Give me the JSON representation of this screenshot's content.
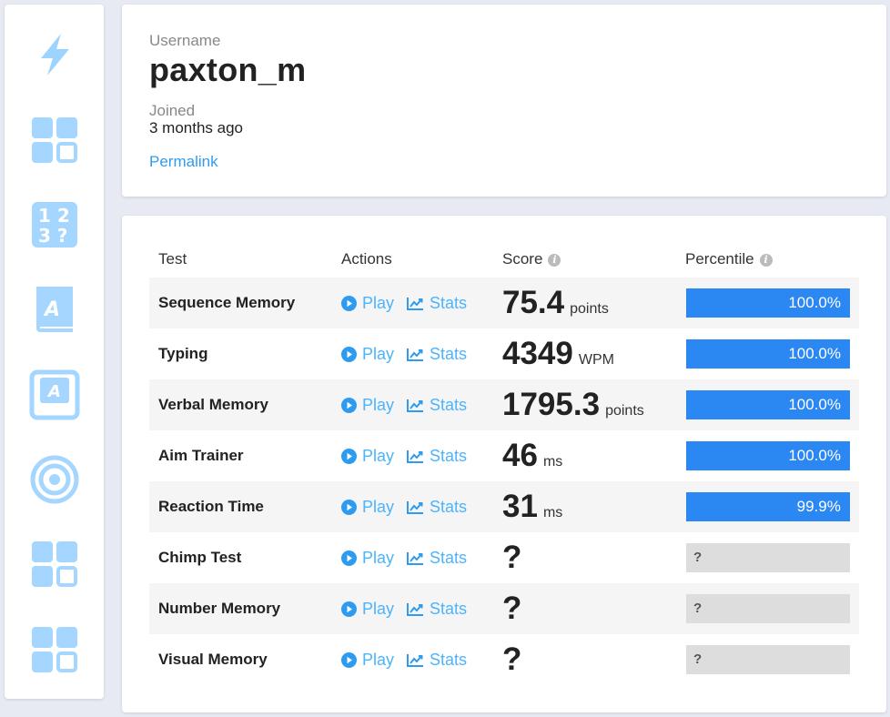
{
  "sidebar": {
    "icons": [
      "lightning-icon",
      "grid-icon",
      "numbers-icon",
      "book-icon",
      "keyboard-key-icon",
      "target-icon",
      "grid-icon",
      "grid-icon"
    ]
  },
  "profile": {
    "username_label": "Username",
    "username": "paxton_m",
    "joined_label": "Joined",
    "joined": "3 months ago",
    "permalink": "Permalink"
  },
  "table": {
    "headers": {
      "test": "Test",
      "actions": "Actions",
      "score": "Score",
      "percentile": "Percentile"
    },
    "play_label": "Play",
    "stats_label": "Stats",
    "rows": [
      {
        "test": "Sequence Memory",
        "score": "75.4",
        "unit": "points",
        "percentile": "100.0%",
        "percentile_value": 100.0
      },
      {
        "test": "Typing",
        "score": "4349",
        "unit": "WPM",
        "percentile": "100.0%",
        "percentile_value": 100.0
      },
      {
        "test": "Verbal Memory",
        "score": "1795.3",
        "unit": "points",
        "percentile": "100.0%",
        "percentile_value": 100.0
      },
      {
        "test": "Aim Trainer",
        "score": "46",
        "unit": "ms",
        "percentile": "100.0%",
        "percentile_value": 100.0
      },
      {
        "test": "Reaction Time",
        "score": "31",
        "unit": "ms",
        "percentile": "99.9%",
        "percentile_value": 99.9
      },
      {
        "test": "Chimp Test",
        "score": "?",
        "unit": "",
        "percentile": "?"
      },
      {
        "test": "Number Memory",
        "score": "?",
        "unit": "",
        "percentile": "?"
      },
      {
        "test": "Visual Memory",
        "score": "?",
        "unit": "",
        "percentile": "?"
      }
    ]
  },
  "colors": {
    "accent": "#2b87f2",
    "link": "#2d9cf0",
    "icon": "#a5d6ff"
  }
}
